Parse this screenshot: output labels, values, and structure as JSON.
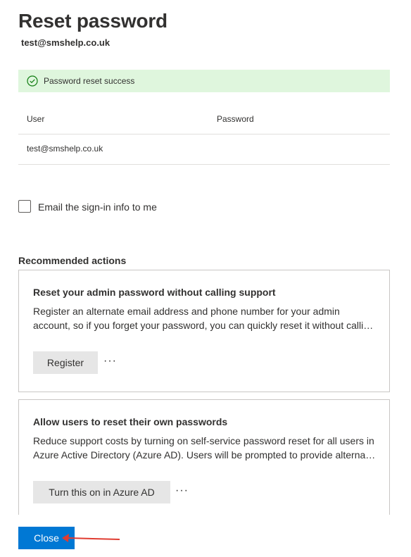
{
  "header": {
    "title": "Reset password",
    "user_email": "test@smshelp.co.uk"
  },
  "notification": {
    "icon": "check-circle-icon",
    "text": "Password reset success",
    "color": "#dff6dd",
    "icon_color": "#107c10"
  },
  "table": {
    "columns": [
      "User",
      "Password"
    ],
    "rows": [
      {
        "user": "test@smshelp.co.uk",
        "password": ""
      }
    ]
  },
  "email_option": {
    "label": "Email the sign-in info to me",
    "checked": false
  },
  "recommended": {
    "title": "Recommended actions",
    "cards": [
      {
        "title": "Reset your admin password without calling support",
        "description_line1": "Register an alternate email address and phone number for your admin",
        "description_line2": "account, so if you forget your password, you can quickly reset it without calling support.",
        "button_label": "Register",
        "more_label": "···"
      },
      {
        "title": "Allow users to reset their own passwords",
        "description_line1": "Reduce support costs by turning on self-service password reset for all users in",
        "description_line2": "Azure Active Directory (Azure AD). Users will be prompted to provide alternate contact info.",
        "button_label": "Turn this on in Azure AD",
        "more_label": "···"
      }
    ]
  },
  "footer": {
    "close_label": "Close",
    "primary_color": "#0078d4",
    "annotation_arrow_color": "#e03c31"
  }
}
